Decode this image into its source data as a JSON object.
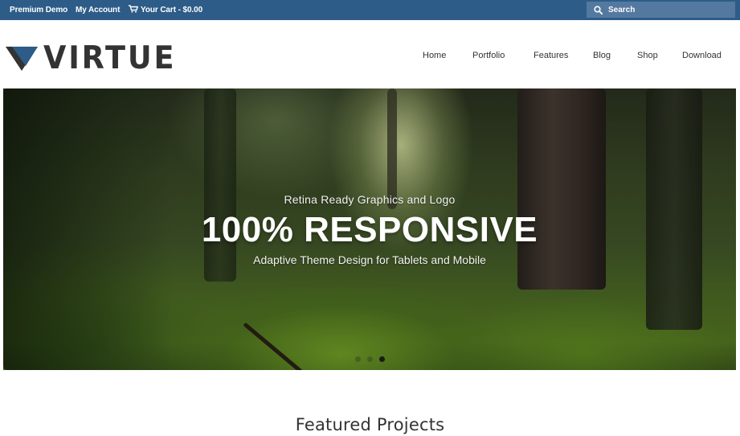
{
  "topbar": {
    "premium_demo": "Premium Demo",
    "my_account": "My Account",
    "cart": "Your Cart - $0.00",
    "search_placeholder": "Search",
    "background_color": "#2d5c88"
  },
  "header": {
    "logo_text": "VIRTUE",
    "nav": {
      "home": "Home",
      "portfolio": "Portfolio",
      "features": "Features",
      "blog": "Blog",
      "shop": "Shop",
      "download": "Download"
    }
  },
  "hero": {
    "kicker": "Retina Ready Graphics and Logo",
    "headline": "100% RESPONSIVE",
    "subline": "Adaptive Theme Design for Tablets and Mobile",
    "slide_count": 3,
    "active_slide": 3
  },
  "featured": {
    "title": "Featured Projects"
  },
  "icons": {
    "cart": "shopping-cart-icon",
    "search": "search-icon"
  }
}
